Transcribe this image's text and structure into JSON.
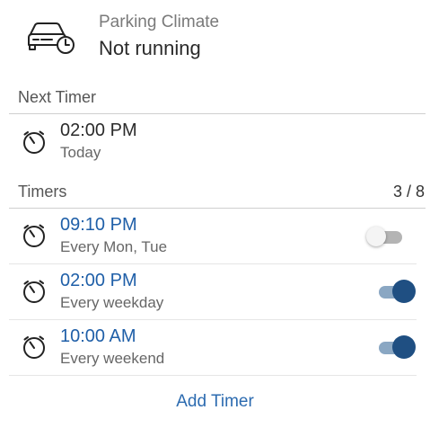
{
  "header": {
    "label": "Parking Climate",
    "status": "Not running",
    "icon": "car-clock-icon"
  },
  "next_timer": {
    "title": "Next Timer",
    "time": "02:00 PM",
    "day": "Today",
    "icon": "stopwatch-icon"
  },
  "timers": {
    "title": "Timers",
    "count": "3 / 8",
    "items": [
      {
        "time": "09:10 PM",
        "repeat": "Every Mon, Tue",
        "enabled": false
      },
      {
        "time": "02:00 PM",
        "repeat": "Every weekday",
        "enabled": true
      },
      {
        "time": "10:00 AM",
        "repeat": "Every weekend",
        "enabled": true
      }
    ]
  },
  "actions": {
    "add_timer": "Add Timer"
  },
  "colors": {
    "accent": "#1f5fa8",
    "toggle_on": "#1f4f82",
    "toggle_off": "#b4b4b4"
  }
}
